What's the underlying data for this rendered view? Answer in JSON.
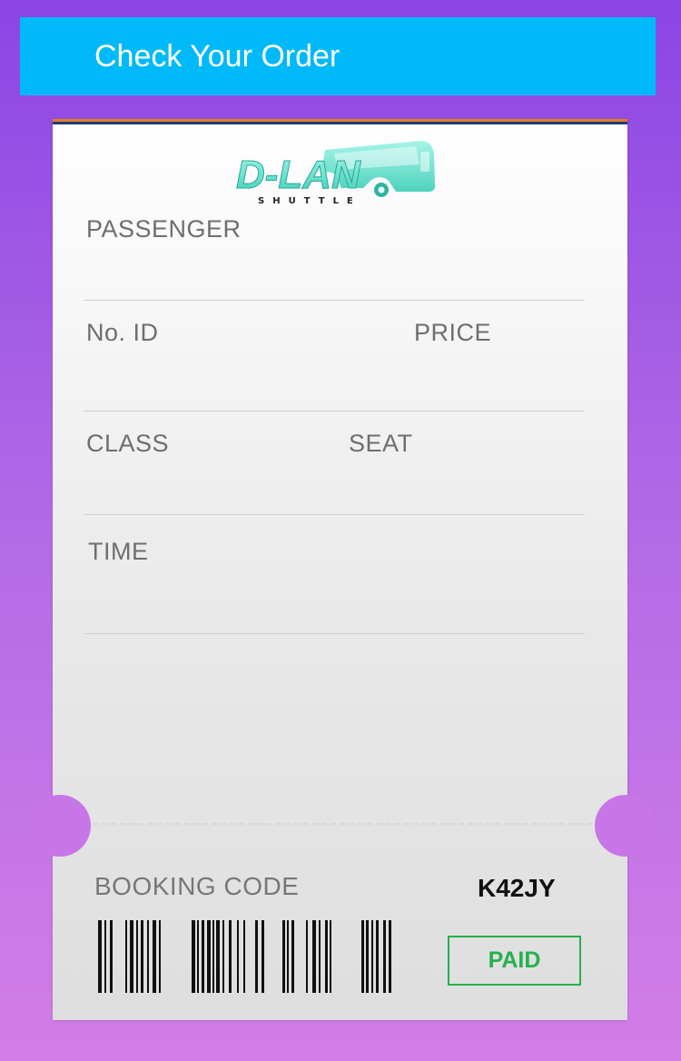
{
  "header": {
    "title": "Check Your Order"
  },
  "logo": {
    "brand": "D-LAN",
    "tagline": "SHUTTLE"
  },
  "fields": {
    "passenger": {
      "label": "PASSENGER",
      "value": ""
    },
    "no_id": {
      "label": "No. ID",
      "value": ""
    },
    "price": {
      "label": "PRICE",
      "value": ""
    },
    "class": {
      "label": "CLASS",
      "value": ""
    },
    "seat": {
      "label": "SEAT",
      "value": ""
    },
    "time": {
      "label": "TIME",
      "value": ""
    }
  },
  "booking": {
    "label": "BOOKING CODE",
    "code": "K42JY",
    "status": "PAID"
  },
  "colors": {
    "header_bg": "#00b9f9",
    "paid_green": "#27b04e",
    "logo_teal": "#5fe3cf",
    "background_top": "#8b45e4",
    "background_bottom": "#d27ee8"
  }
}
